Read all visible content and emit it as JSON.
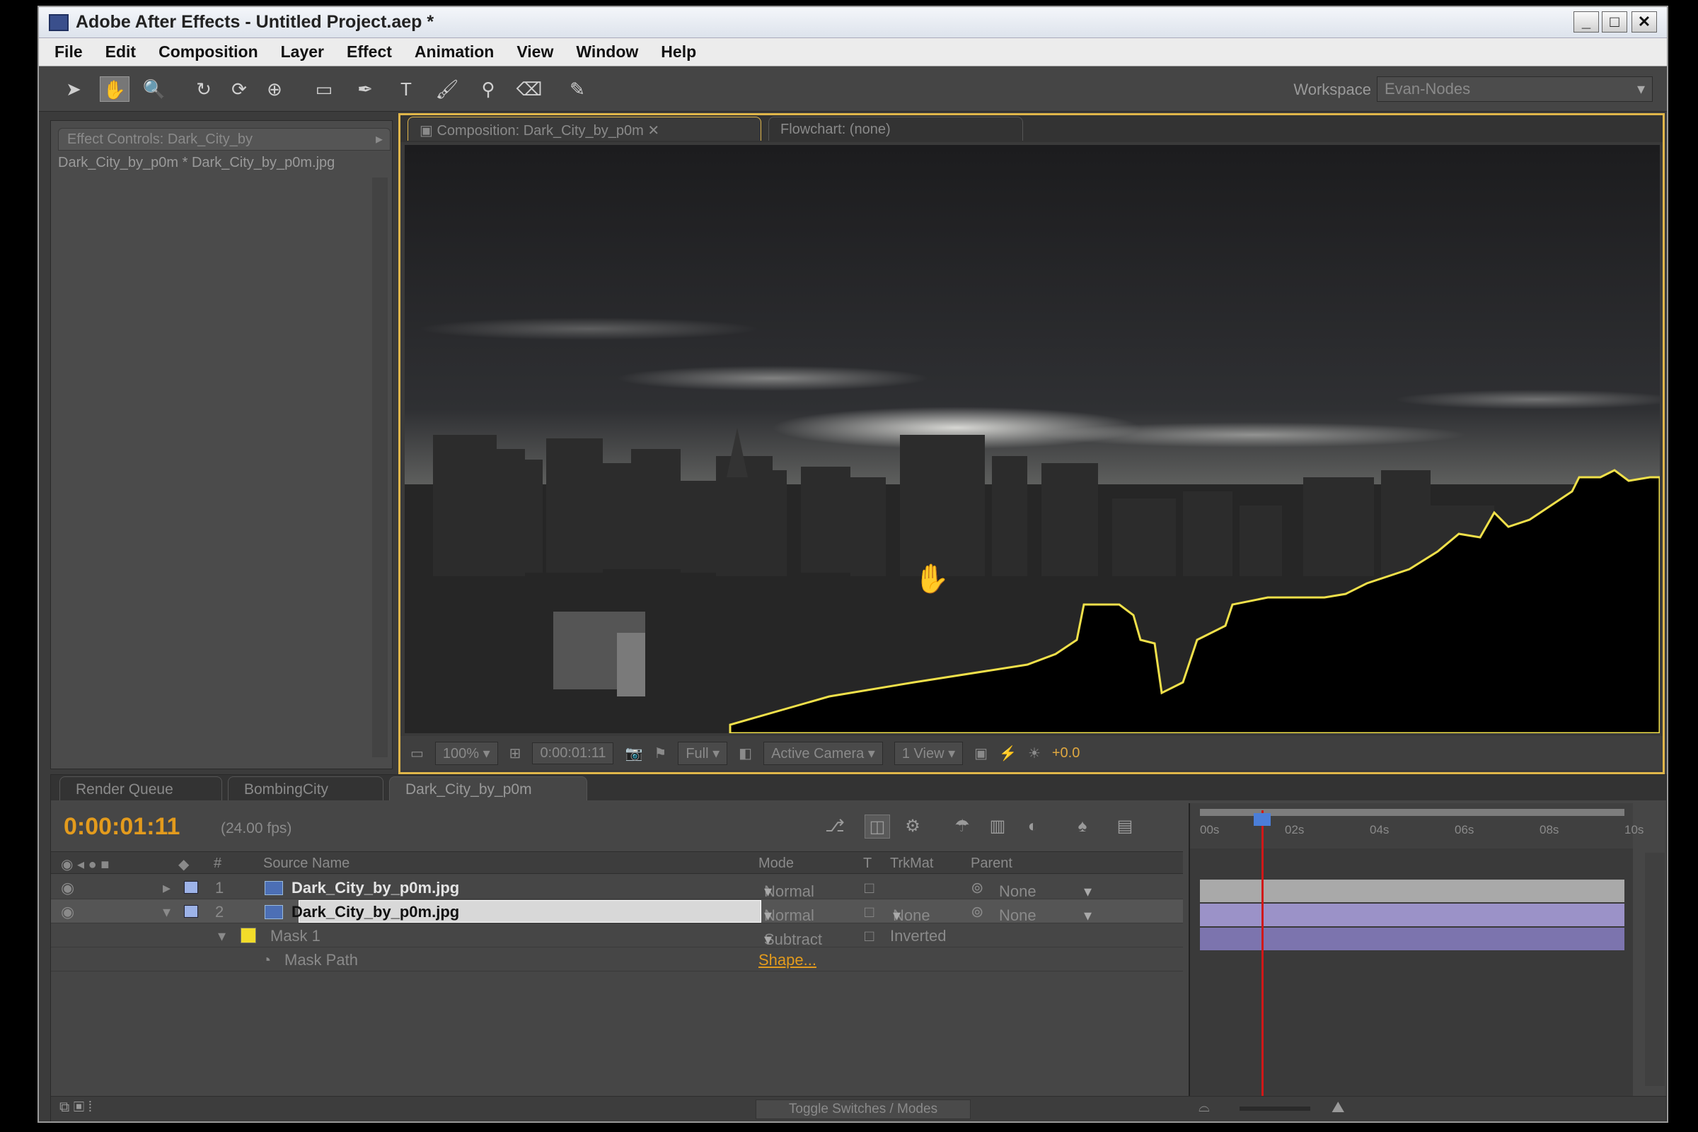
{
  "window": {
    "title": "Adobe After Effects - Untitled Project.aep *",
    "controls": [
      "_",
      "□",
      "✕"
    ]
  },
  "menu": [
    "File",
    "Edit",
    "Composition",
    "Layer",
    "Effect",
    "Animation",
    "View",
    "Window",
    "Help"
  ],
  "toolbar": {
    "tools": [
      {
        "name": "selection-tool-icon",
        "glyph": "➤"
      },
      {
        "name": "hand-tool-icon",
        "glyph": "✋",
        "active": true
      },
      {
        "name": "zoom-tool-icon",
        "glyph": "🔍"
      },
      {
        "name": "rotation-tool-icon",
        "glyph": "↻"
      },
      {
        "name": "orbit-camera-tool-icon",
        "glyph": "⟳"
      },
      {
        "name": "pan-behind-tool-icon",
        "glyph": "⊕"
      },
      {
        "name": "rectangle-mask-tool-icon",
        "glyph": "▭"
      },
      {
        "name": "pen-tool-icon",
        "glyph": "✒"
      },
      {
        "name": "type-tool-icon",
        "glyph": "T"
      },
      {
        "name": "brush-tool-icon",
        "glyph": "🖌"
      },
      {
        "name": "clone-stamp-tool-icon",
        "glyph": "⚲"
      },
      {
        "name": "eraser-tool-icon",
        "glyph": "⌫"
      },
      {
        "name": "puppet-pin-tool-icon",
        "glyph": "✎"
      }
    ],
    "workspace_label": "Workspace",
    "workspace_value": "Evan-Nodes"
  },
  "effect_controls": {
    "tab": "Effect Controls: Dark_City_by",
    "subtitle": "Dark_City_by_p0m * Dark_City_by_p0m.jpg"
  },
  "composition": {
    "tab": "Composition: Dark_City_by_p0m",
    "flowchart_tab": "Flowchart: (none)",
    "viewer": {
      "zoom": "100%",
      "timecode": "0:00:01:11",
      "resolution": "Full",
      "camera": "Active Camera",
      "views": "1 View",
      "exposure": "+0.0"
    }
  },
  "timeline": {
    "tabs": [
      "Render Queue",
      "BombingCity",
      "Dark_City_by_p0m"
    ],
    "timecode": "0:00:01:11",
    "fps": "(24.00 fps)",
    "columns": {
      "num": "#",
      "source_name": "Source Name",
      "mode": "Mode",
      "t": "T",
      "trkmat": "TrkMat",
      "parent": "Parent"
    },
    "layers": [
      {
        "num": "1",
        "name": "Dark_City_by_p0m.jpg",
        "mode": "Normal",
        "trkmat": "",
        "parent": "None"
      },
      {
        "num": "2",
        "name": "Dark_City_by_p0m.jpg",
        "mode": "Normal",
        "trkmat": "None",
        "parent": "None"
      }
    ],
    "mask": {
      "name": "Mask 1",
      "mode": "Subtract",
      "inverted": "Inverted"
    },
    "mask_path": {
      "name": "Mask Path",
      "value": "Shape..."
    },
    "ruler_ticks": [
      "00s",
      "02s",
      "04s",
      "06s",
      "08s",
      "10s"
    ],
    "playhead_seconds": 1.46,
    "footer_toggle": "Toggle Switches / Modes"
  },
  "colors": {
    "accent": "#e39b1d",
    "panel_highlight": "#e0b64a",
    "mask_outline": "#f0e04a",
    "playhead": "#d01818",
    "layer_bar": "#9b92c8"
  }
}
